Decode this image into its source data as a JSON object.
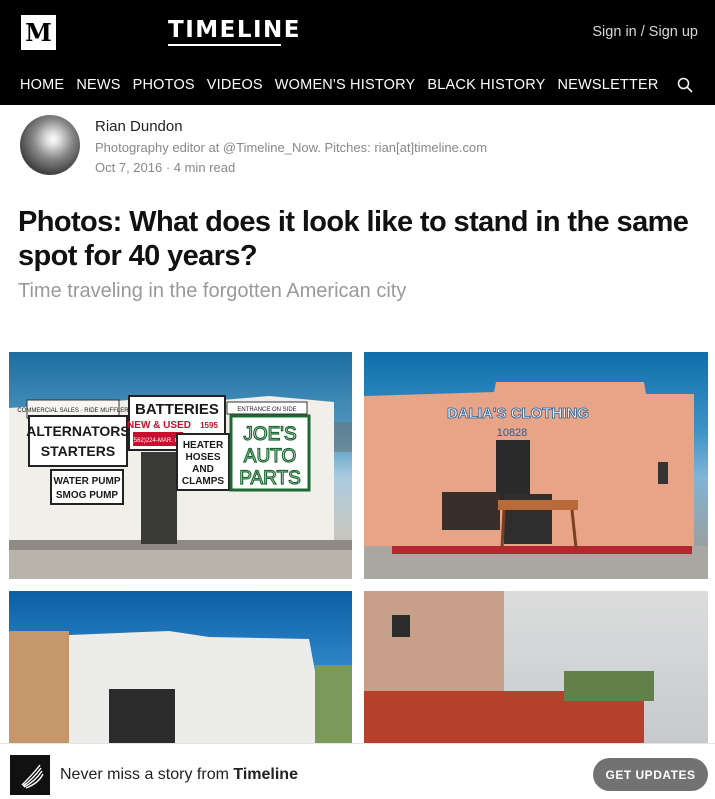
{
  "header": {
    "logo_letter": "M",
    "brand": "TIMELINE",
    "signin": "Sign in / Sign up",
    "nav": [
      "HOME",
      "NEWS",
      "PHOTOS",
      "VIDEOS",
      "WOMEN'S HISTORY",
      "BLACK HISTORY",
      "NEWSLETTER"
    ],
    "search_icon": "search-icon"
  },
  "author": {
    "name": "Rian Dundon",
    "bio": "Photography editor at @Timeline_Now. Pitches: rian[at]timeline.com",
    "meta": "Oct 7, 2016 · 4 min read"
  },
  "article": {
    "title": "Photos: What does it look like to stand in the same spot for 40 years?",
    "subtitle": "Time traveling in the forgotten American city"
  },
  "photos": {
    "p1": {
      "sign_left_small": "COMMERCIAL SALES · RIDE MUFFLER",
      "sign_alt1": "ALTERNATORS",
      "sign_alt2": "STARTERS",
      "sign_batteries": "BATTERIES",
      "sign_new_used": "NEW & USED",
      "sign_price": "1595",
      "sign_phone": "(562)224-MAR. OM",
      "sign_heater1": "HEATER",
      "sign_heater2": "HOSES",
      "sign_heater3": "AND",
      "sign_heater4": "CLAMPS",
      "sign_entrance": "ENTRANCE ON SIDE",
      "sign_joes1": "JOE'S",
      "sign_joes2": "AUTO",
      "sign_joes3": "PARTS",
      "sign_water1": "WATER PUMP",
      "sign_water2": "SMOG PUMP"
    },
    "p2": {
      "store_sign": "DALIA'S CLOTHING",
      "address": "10828"
    }
  },
  "cta": {
    "text_prefix": "Never miss a story from ",
    "text_brand": "Timeline",
    "button": "GET UPDATES"
  }
}
